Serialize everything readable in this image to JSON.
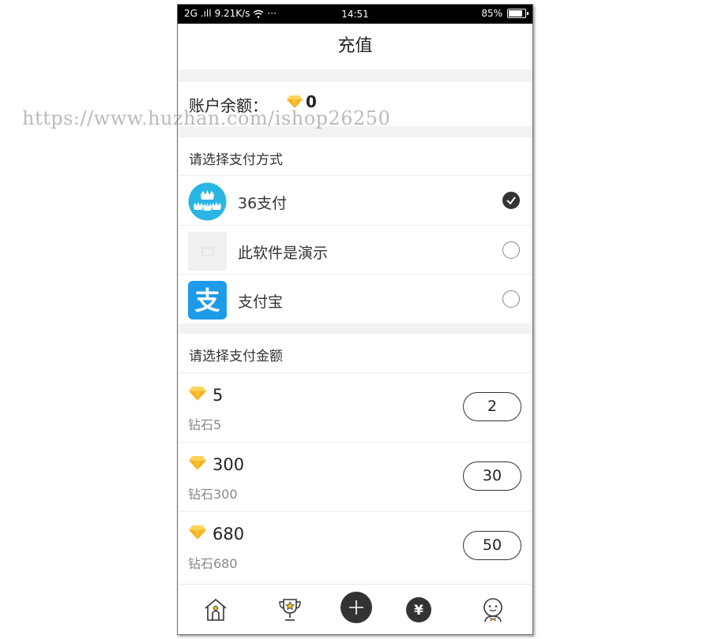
{
  "status_bar": {
    "signal": "2G .ıll",
    "speed": "9.21K/s",
    "dots": "···",
    "time": "14:51",
    "battery_text": "85%",
    "battery_level": 0.85
  },
  "header": {
    "title": "充值"
  },
  "balance": {
    "label": "账户余额：",
    "value": "0"
  },
  "payment": {
    "section_title": "请选择支付方式",
    "methods": [
      {
        "name": "36支付",
        "icon": "crown-logo-icon",
        "selected": true
      },
      {
        "name": "此软件是演示",
        "icon": "placeholder-image-icon",
        "selected": false
      },
      {
        "name": "支付宝",
        "icon": "alipay-logo-icon",
        "selected": false
      }
    ]
  },
  "amounts": {
    "section_title": "请选择支付金额",
    "items": [
      {
        "amount": "5",
        "desc": "钻石5",
        "price": "2"
      },
      {
        "amount": "300",
        "desc": "钻石300",
        "price": "30"
      },
      {
        "amount": "680",
        "desc": "钻石680",
        "price": "50"
      }
    ]
  },
  "tabbar": {
    "items": [
      {
        "icon": "home-icon"
      },
      {
        "icon": "trophy-icon"
      },
      {
        "icon": "plus-icon"
      },
      {
        "icon": "yuan-icon"
      },
      {
        "icon": "profile-icon"
      }
    ]
  },
  "watermark": "https://www.huzhan.com/ishop26250",
  "colors": {
    "gem": "#f7b21b",
    "accent": "#333333",
    "alipay": "#1e9be8",
    "crown_logo": "#29b6e3"
  }
}
